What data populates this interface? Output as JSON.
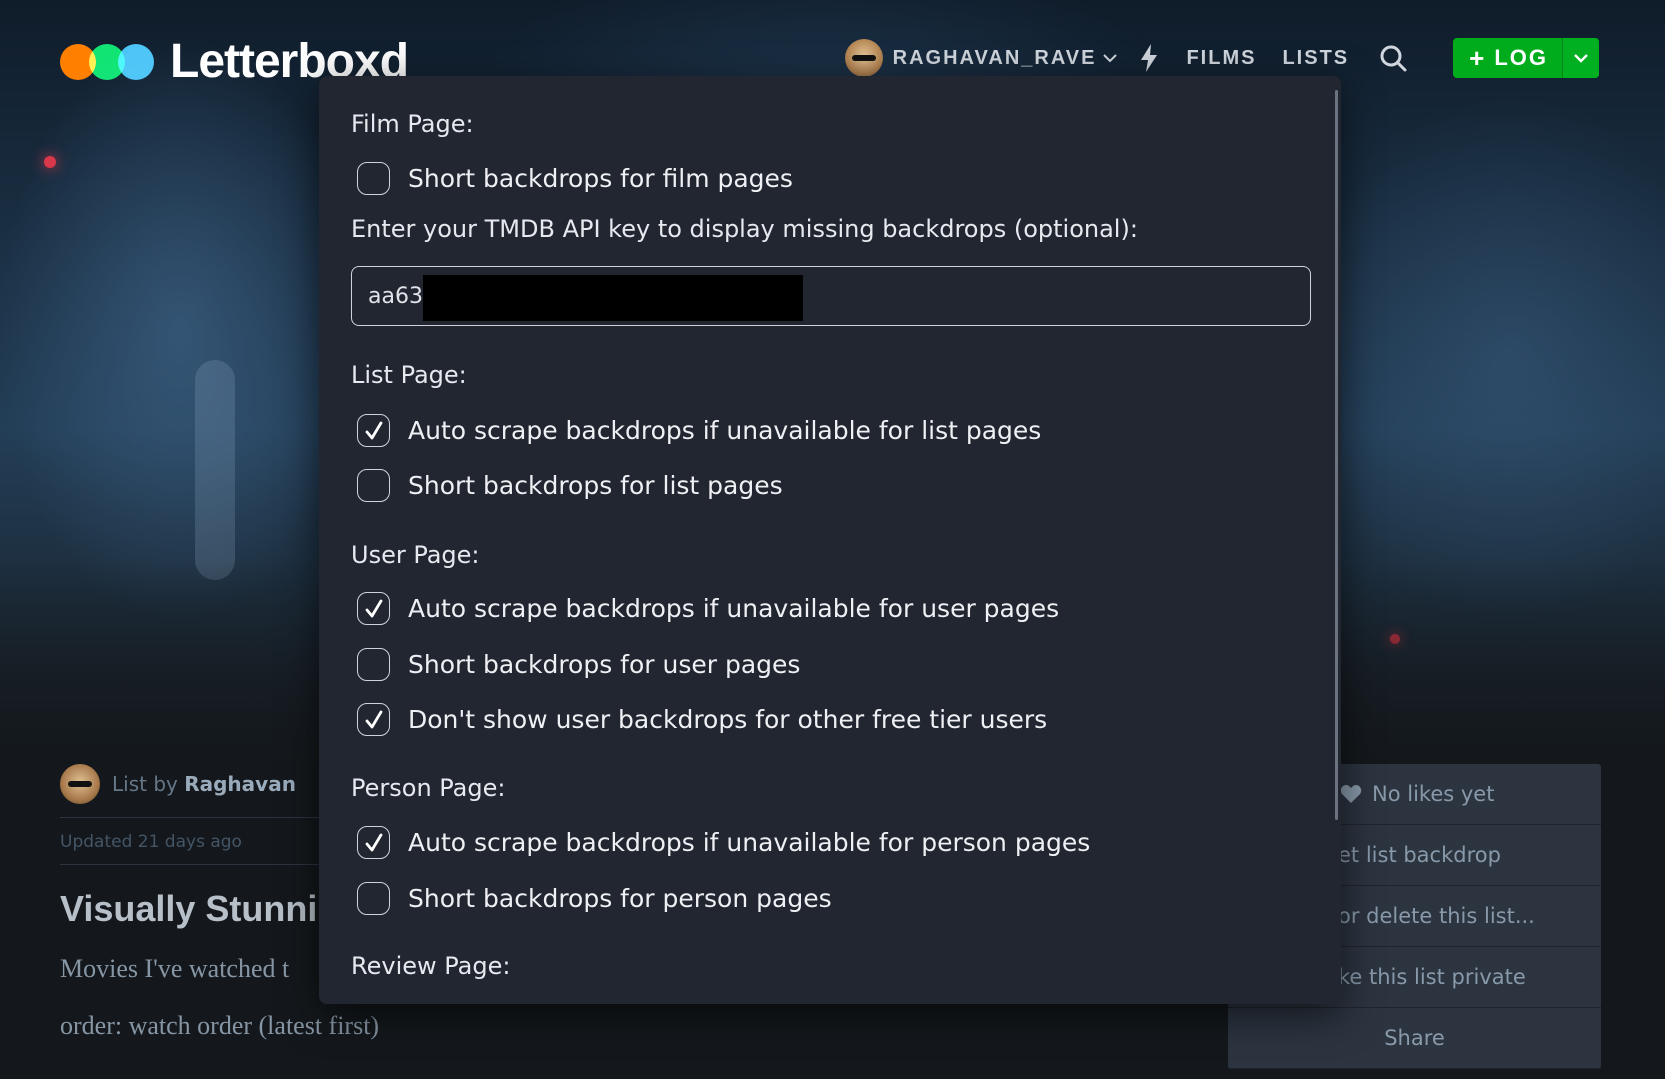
{
  "header": {
    "logo_text": "Letterboxd",
    "username": "RAGHAVAN_RAVE",
    "nav_films": "FILMS",
    "nav_lists": "LISTS",
    "log_label": "LOG",
    "log_plus": "+",
    "brand_colors": {
      "orange": "#ff8000",
      "green": "#00e054",
      "blue": "#40bcf4",
      "log_button": "#00ac1c"
    }
  },
  "page": {
    "list_by_prefix": "List by",
    "list_owner": "Raghavan",
    "updated": "Updated 21 days ago",
    "list_title": "Visually Stunni",
    "desc_line1": "Movies I've watched t",
    "desc_line2": "order: watch order (latest first)"
  },
  "side_panel": {
    "likes": "No likes yet",
    "row2": "et list backdrop",
    "row3": "or delete this list...",
    "row4": "ke this list private",
    "share": "Share"
  },
  "popup": {
    "film_page": {
      "heading": "Film Page:",
      "short_backdrops": {
        "label": "Short backdrops for film pages",
        "checked": false
      }
    },
    "api_key": {
      "label": "Enter your TMDB API key to display missing backdrops (optional):",
      "value": "aa63"
    },
    "list_page": {
      "heading": "List Page:",
      "auto_scrape": {
        "label": "Auto scrape backdrops if unavailable for list pages",
        "checked": true
      },
      "short_backdrops": {
        "label": "Short backdrops for list pages",
        "checked": false
      }
    },
    "user_page": {
      "heading": "User Page:",
      "auto_scrape": {
        "label": "Auto scrape backdrops if unavailable for user pages",
        "checked": true
      },
      "short_backdrops": {
        "label": "Short backdrops for user pages",
        "checked": false
      },
      "hide_free_tier": {
        "label": "Don't show user backdrops for other free tier users",
        "checked": true
      }
    },
    "person_page": {
      "heading": "Person Page:",
      "auto_scrape": {
        "label": "Auto scrape backdrops if unavailable for person pages",
        "checked": true
      },
      "short_backdrops": {
        "label": "Short backdrops for person pages",
        "checked": false
      }
    },
    "review_page": {
      "heading": "Review Page:"
    }
  }
}
